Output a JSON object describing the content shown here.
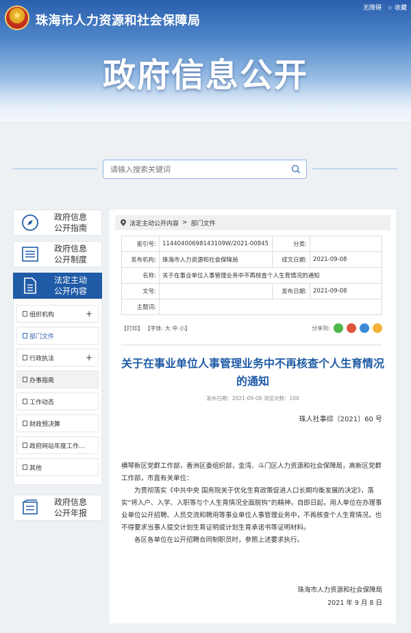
{
  "header": {
    "site_title": "珠海市人力资源和社会保障局",
    "banner_title": "政府信息公开",
    "toplinks": [
      "无障碍",
      "☆ 收藏"
    ]
  },
  "search": {
    "placeholder": "请输入搜索关键词"
  },
  "sidebar": {
    "cards": [
      {
        "label": "政府信息\n公开指南",
        "icon": "compass-icon"
      },
      {
        "label": "政府信息\n公开制度",
        "icon": "list-icon"
      },
      {
        "label": "法定主动\n公开内容",
        "icon": "document-icon"
      },
      {
        "label": "政府信息\n公开年报",
        "icon": "report-icon"
      }
    ],
    "subitems": [
      {
        "label": "组织机构",
        "plus": "+"
      },
      {
        "label": "部门文件",
        "plus": ""
      },
      {
        "label": "行政执法",
        "plus": "+"
      },
      {
        "label": "办事指南",
        "plus": ""
      },
      {
        "label": "工作动态",
        "plus": ""
      },
      {
        "label": "财政预决算",
        "plus": ""
      },
      {
        "label": "政府网站年度工作...",
        "plus": ""
      },
      {
        "label": "其他",
        "plus": ""
      }
    ]
  },
  "breadcrumb": {
    "item1": "法定主动公开内容",
    "sep": ">",
    "item2": "部门文件"
  },
  "meta": {
    "index_key": "索引号:",
    "index_val": "11440400698143109W/2021-00845",
    "category_key": "分类:",
    "category_val": "",
    "issuer_key": "发布机构:",
    "issuer_val": "珠海市人力资源和社会保障局",
    "created_key": "成文日期:",
    "created_val": "2021-09-08",
    "name_key": "名称:",
    "name_val": "关于在事业单位人事管理业务中不再核查个人生育情况的通知",
    "docno_key": "文号:",
    "docno_val": "",
    "published_key": "发布日期:",
    "published_val": "2021-09-08",
    "subject_key": "主题词:",
    "subject_val": ""
  },
  "tools": {
    "print": "【打印】",
    "font_label": "【字体:",
    "big": "大",
    "mid": "中",
    "small": "小】",
    "share_label": "分享到:"
  },
  "share_colors": [
    "#4cb84a",
    "#e0533d",
    "#3b8ad8",
    "#f3b23a"
  ],
  "document": {
    "title": "关于在事业单位人事管理业务中不再核查个人生育情况的通知",
    "pub_info": "发布日期：2021-09-08   浏览次数：100",
    "doc_number": "珠人社事综〔2021〕60 号",
    "salutation": "横琴新区党群工作部，香洲区委组织部，金湾、斗门区人力资源和社会保障局，高新区党群工作部，市直有关单位：",
    "para1": "为贯彻落实《中共中央 国务院关于优化生育政策促进人口长期均衡发展的决定》，落实“将入户、入学、入职等与个人生育情况全面脱钩”的精神，自即日起，用人单位在办理事业单位公开招聘、人员交流和聘用等事业单位人事管理业务中，不再核查个人生育情况，也不得要求当事人提交计划生育证明或计划生育承诺书等证明材料。",
    "para2": "各区各单位在公开招聘合同制职员时，参照上述要求执行。",
    "signature": "珠海市人力资源和社会保障局",
    "sign_date": "2021 年 9 月 8 日"
  }
}
